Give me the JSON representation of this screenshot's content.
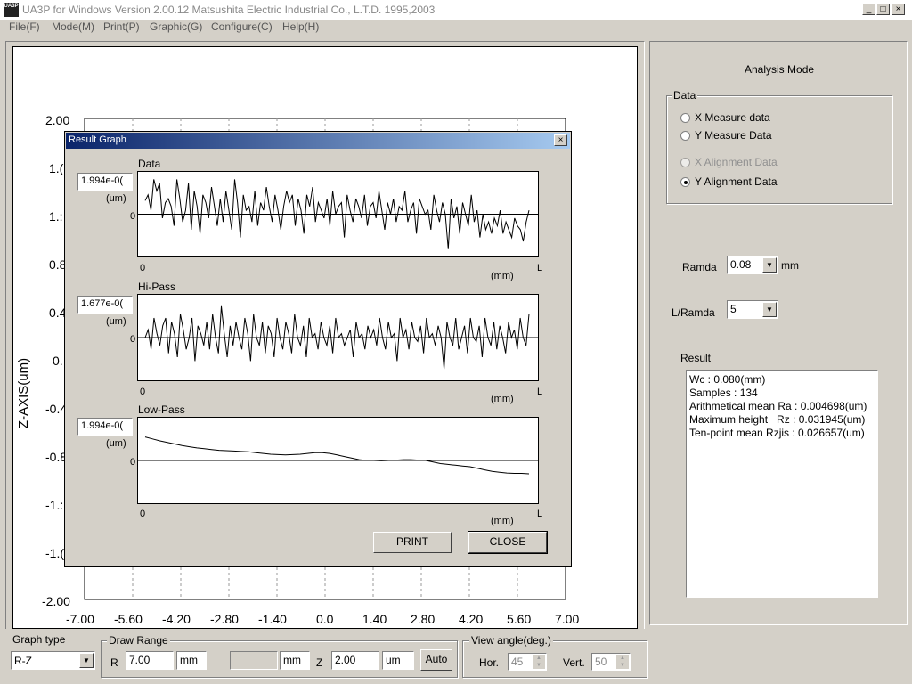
{
  "window": {
    "title": "UA3P for Windows Version 2.00.12   Matsushita Electric Industrial Co., L.T.D. 1995,2003",
    "icon_text": "UA3P",
    "min_label": "_",
    "max_label": "□",
    "close_label": "×"
  },
  "menu": [
    {
      "label": "File(F)"
    },
    {
      "label": "Mode(M)"
    },
    {
      "label": "Print(P)"
    },
    {
      "label": "Graphic(G)"
    },
    {
      "label": "Configure(C)"
    },
    {
      "label": "Help(H)"
    }
  ],
  "main_plot": {
    "ylabel": "Z-AXIS(um)",
    "yticks_visible": [
      "2.00",
      "1.6",
      "1.2",
      "0.8",
      "0.4",
      "0.",
      "-0.4",
      "-0.8",
      "-1.2",
      "-1.6",
      "-2.00"
    ],
    "xticks": [
      "-7.00",
      "-5.60",
      "-4.20",
      "-2.80",
      "-1.40",
      "0.0",
      "1.40",
      "2.80",
      "4.20",
      "5.60",
      "7.00"
    ],
    "yticks_display": [
      "2.00",
      "1.(",
      "1.:",
      "0.8",
      "0.4",
      "0.",
      "-0.4",
      "-0.8",
      "-1.:",
      "-1.(",
      "-2.00"
    ]
  },
  "dialog": {
    "title": "Result Graph",
    "close_label": "×",
    "graphs": [
      {
        "label": "Data",
        "value": "1.994e-0(",
        "unit": "(um)",
        "zero": "0",
        "x0": "0",
        "xunit": "(mm)",
        "xend": "L"
      },
      {
        "label": "Hi-Pass",
        "value": "1.677e-0(",
        "unit": "(um)",
        "zero": "0",
        "x0": "0",
        "xunit": "(mm)",
        "xend": "L"
      },
      {
        "label": "Low-Pass",
        "value": "1.994e-0(",
        "unit": "(um)",
        "zero": "0",
        "x0": "0",
        "xunit": "(mm)",
        "xend": "L"
      }
    ],
    "print_label": "PRINT",
    "close_button_label": "CLOSE"
  },
  "right_panel": {
    "heading": "Analysis Mode",
    "data_group": "Data",
    "radios": [
      {
        "label": "X Measure data",
        "checked": false,
        "disabled": false
      },
      {
        "label": "Y Measure Data",
        "checked": false,
        "disabled": false
      },
      {
        "label": "X Alignment Data",
        "checked": false,
        "disabled": true
      },
      {
        "label": "Y Alignment Data",
        "checked": true,
        "disabled": false
      }
    ],
    "ramda_label": "Ramda",
    "ramda_value": "0.08",
    "ramda_unit": "mm",
    "lramda_label": "L/Ramda",
    "lramda_value": "5",
    "result_label": "Result",
    "result_lines": [
      "Wc : 0.080(mm)",
      "Samples : 134",
      "Arithmetical mean Ra : 0.004698(um)",
      "Maximum height   Rz : 0.031945(um)",
      "Ten-point mean Rzjis : 0.026657(um)"
    ]
  },
  "bottom": {
    "graph_type_label": "Graph type",
    "graph_type_value": "R-Z",
    "draw_range_label": "Draw Range",
    "r_label": "R",
    "r_value": "7.00",
    "r_unit": "mm",
    "blank_value": "",
    "blank_unit": "mm",
    "z_label": "Z",
    "z_value": "2.00",
    "z_unit": "um",
    "auto_label": "Auto",
    "view_angle_label": "View angle(deg.)",
    "hor_label": "Hor.",
    "hor_value": "45",
    "vert_label": "Vert.",
    "vert_value": "50"
  },
  "chart_data": [
    {
      "type": "line",
      "title": "Data",
      "series": [
        {
          "values": [
            0.35,
            0.5,
            0.1,
            0.9,
            0.6,
            0.8,
            -0.1,
            0.3,
            0.4,
            0.2,
            -0.3,
            0.9,
            0.4,
            -0.2,
            0.1,
            0.8,
            -0.4,
            0.6,
            0.2,
            -0.5,
            0.5,
            0.3,
            -0.1,
            0.7,
            0.2,
            -0.3,
            0.4,
            -0.2,
            0.6,
            0.1,
            -0.4,
            0.9,
            0.3,
            -0.6,
            0.5,
            0.1,
            0.2,
            -0.2,
            0.6,
            -0.3,
            0.3,
            0.1,
            0.7,
            0.2,
            -0.2,
            0.5,
            0.1,
            -0.4,
            0.2,
            0.6,
            0.3,
            0.5,
            -0.3,
            0.4,
            0.1,
            -0.5,
            0.5,
            0.2,
            0.7,
            -0.2,
            0.3,
            0.1,
            -0.1,
            0.4,
            -0.3,
            0.6,
            0.0,
            0.2,
            0.3,
            -0.6,
            0.5,
            0.1,
            -0.2,
            0.4,
            0.2,
            -0.1,
            0.5,
            -0.3,
            0.2,
            0.3,
            -0.1,
            0.6,
            0.1,
            -0.4,
            0.3,
            0.0,
            0.4,
            -0.2,
            0.2,
            0.1,
            0.6,
            -0.2,
            0.1,
            0.3,
            -0.5,
            0.4,
            0.2,
            0.0,
            0.1,
            -0.4,
            0.5,
            0.1,
            -0.2,
            0.3,
            0.0,
            -0.9,
            0.4,
            -0.1,
            0.2,
            -0.5,
            0.3,
            0.0,
            -0.3,
            0.5,
            -0.2,
            0.1,
            -0.6,
            0.0,
            -0.4,
            -0.2,
            -0.5,
            -0.1,
            -0.3,
            0.1,
            -0.5,
            -0.2,
            -0.4,
            -0.6,
            -0.1,
            -0.3,
            -0.4,
            -0.7,
            -0.2,
            0.1
          ]
        }
      ],
      "ylim": [
        -1,
        1
      ]
    },
    {
      "type": "line",
      "title": "Hi-Pass",
      "series": [
        {
          "values": [
            0.0,
            0.2,
            -0.3,
            0.5,
            0.1,
            -0.2,
            0.3,
            0.5,
            -0.4,
            0.4,
            0.1,
            -0.5,
            0.6,
            0.2,
            -0.3,
            0.0,
            0.5,
            -0.6,
            0.3,
            0.1,
            -0.2,
            0.4,
            -0.3,
            0.6,
            0.0,
            -0.4,
            0.8,
            0.1,
            -0.5,
            0.3,
            -0.2,
            0.4,
            0.0,
            -0.3,
            0.5,
            0.1,
            -0.6,
            0.6,
            0.0,
            -0.2,
            0.4,
            -0.4,
            0.3,
            0.1,
            -0.5,
            0.5,
            0.0,
            -0.3,
            0.4,
            0.1,
            -0.4,
            0.6,
            0.0,
            -0.2,
            0.3,
            -0.5,
            0.5,
            0.0,
            0.1,
            -0.3,
            0.4,
            0.0,
            -0.2,
            0.3,
            -0.4,
            0.5,
            0.0,
            0.1,
            -0.2,
            0.0,
            0.2,
            -0.5,
            0.4,
            0.0,
            0.1,
            -0.3,
            0.3,
            0.0,
            0.2,
            -0.2,
            0.5,
            0.0,
            -0.3,
            0.4,
            0.0,
            0.1,
            -0.6,
            0.5,
            0.0,
            0.2,
            -0.3,
            0.4,
            0.0,
            -0.1,
            0.3,
            -0.4,
            0.5,
            0.0,
            0.1,
            -0.2,
            0.3,
            0.0,
            -0.8,
            0.4,
            0.0,
            -0.2,
            0.5,
            -0.3,
            0.0,
            0.3,
            -0.4,
            0.5,
            0.0,
            -0.1,
            0.3,
            -0.5,
            0.5,
            0.0,
            -0.2,
            0.4,
            -0.3,
            0.3,
            0.0,
            -0.4,
            0.4,
            0.0,
            0.2,
            -0.3,
            0.5,
            0.0,
            -0.2,
            0.6
          ]
        }
      ],
      "ylim": [
        -1,
        1
      ]
    },
    {
      "type": "line",
      "title": "Low-Pass",
      "series": [
        {
          "values": [
            0.6,
            0.55,
            0.5,
            0.46,
            0.42,
            0.38,
            0.35,
            0.32,
            0.3,
            0.28,
            0.26,
            0.25,
            0.24,
            0.23,
            0.22,
            0.2,
            0.18,
            0.16,
            0.15,
            0.14,
            0.15,
            0.16,
            0.18,
            0.2,
            0.2,
            0.18,
            0.14,
            0.1,
            0.06,
            0.02,
            0.0,
            0.0,
            -0.01,
            0.0,
            0.01,
            0.02,
            0.02,
            0.01,
            0.0,
            -0.04,
            -0.08,
            -0.1,
            -0.12,
            -0.14,
            -0.16,
            -0.2,
            -0.24,
            -0.28,
            -0.3,
            -0.32,
            -0.33,
            -0.33,
            -0.34
          ]
        }
      ],
      "ylim": [
        -1,
        1
      ]
    }
  ]
}
